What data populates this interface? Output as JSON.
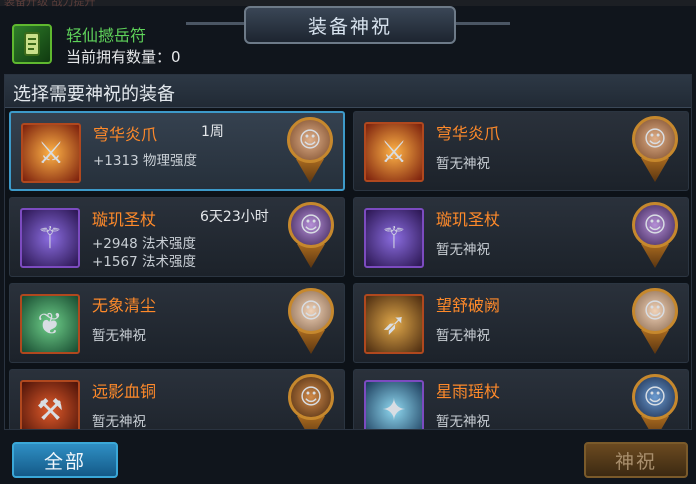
{
  "top_strip": "装备升级   战力提升",
  "charm": {
    "name": "轻仙撼岳符",
    "count_label": "当前拥有数量：0",
    "icon": "scroll-icon"
  },
  "title": "装备神祝",
  "panel": {
    "heading": "选择需要神祝的装备"
  },
  "items": [
    {
      "name": "穹华炎爪",
      "time": "1周",
      "stats": [
        "+1313 物理强度"
      ],
      "icon": "claw-icon",
      "hero": "hero-portrait",
      "selected": true
    },
    {
      "name": "穹华炎爪",
      "time": "",
      "stats": [
        "暂无神祝"
      ],
      "icon": "claw-icon",
      "hero": "hero-portrait",
      "selected": false
    },
    {
      "name": "璇玑圣杖",
      "time": "6天23小时",
      "stats": [
        "+2948 法术强度",
        "+1567 法术强度"
      ],
      "icon": "staff-icon",
      "hero": "hero-portrait",
      "selected": false
    },
    {
      "name": "璇玑圣杖",
      "time": "",
      "stats": [
        "暂无神祝"
      ],
      "icon": "staff-icon",
      "hero": "hero-portrait",
      "selected": false
    },
    {
      "name": "无象清尘",
      "time": "",
      "stats": [
        "暂无神祝"
      ],
      "icon": "whisk-icon",
      "hero": "hero-portrait",
      "selected": false
    },
    {
      "name": "望舒破阙",
      "time": "",
      "stats": [
        "暂无神祝"
      ],
      "icon": "bow-icon",
      "hero": "hero-portrait",
      "selected": false
    },
    {
      "name": "远影血铜",
      "time": "",
      "stats": [
        "暂无神祝"
      ],
      "icon": "mace-icon",
      "hero": "hero-portrait",
      "selected": false
    },
    {
      "name": "星雨瑶杖",
      "time": "",
      "stats": [
        "暂无神祝"
      ],
      "icon": "orb-staff-icon",
      "hero": "hero-portrait",
      "selected": false
    }
  ],
  "buttons": {
    "all": "全部",
    "bless": "神祝"
  },
  "colors": {
    "item_name": "#ff8a2a",
    "charm_name": "#5fd35a",
    "selected_border": "#3d9ac9"
  }
}
